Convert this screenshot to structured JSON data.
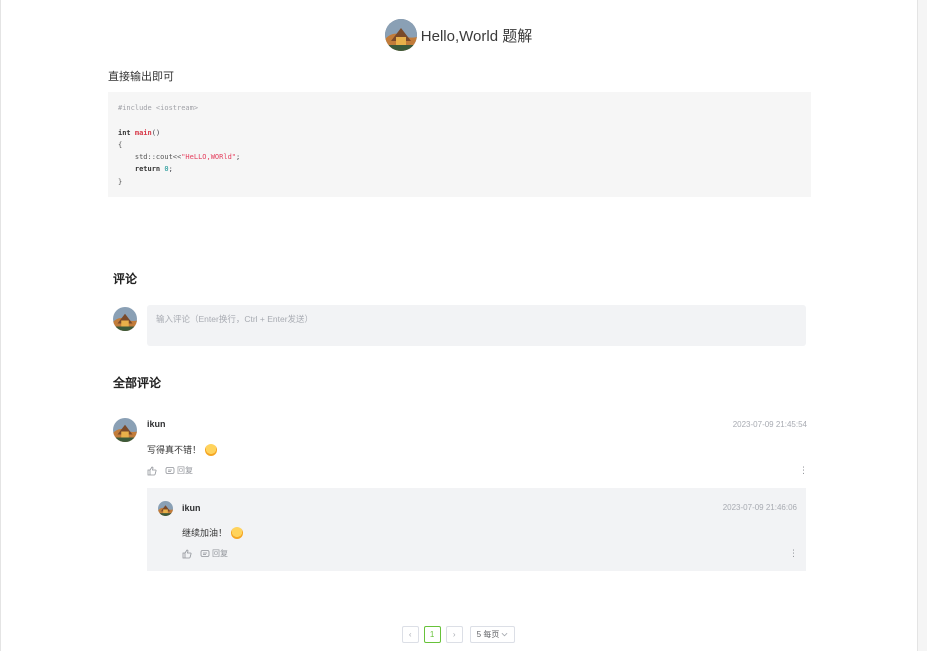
{
  "header": {
    "title": "Hello,World 题解"
  },
  "intro": "直接输出即可",
  "code": {
    "include": "#include <iostream>",
    "int_kw": "int",
    "main_fn": "main",
    "main_paren": "()",
    "open_brace": "{",
    "cout": "std::cout<<",
    "string_literal": "\"HeLLO,WORld\"",
    "semicolon": ";",
    "return_kw": "return",
    "zero": "0",
    "close_brace": "}"
  },
  "comments_section": {
    "title": "评论",
    "input_placeholder": "输入评论（Enter换行，Ctrl + Enter发送）"
  },
  "all_comments": {
    "title": "全部评论",
    "items": [
      {
        "user": "ikun",
        "time": "2023-07-09 21:45:54",
        "text": "写得真不错！",
        "reply_label": "回复",
        "more": "⋮",
        "replies": [
          {
            "user": "ikun",
            "time": "2023-07-09 21:46:06",
            "text": "继续加油！",
            "reply_label": "回复",
            "more": "⋮"
          }
        ]
      }
    ]
  },
  "pagination": {
    "prev": "‹",
    "current_page": "1",
    "next": "›",
    "page_size": "5 每页"
  },
  "colors": {
    "accent_green": "#67c23a",
    "code_bg": "#f6f6f6",
    "input_bg": "#f2f3f5",
    "string_red": "#e4405f"
  }
}
